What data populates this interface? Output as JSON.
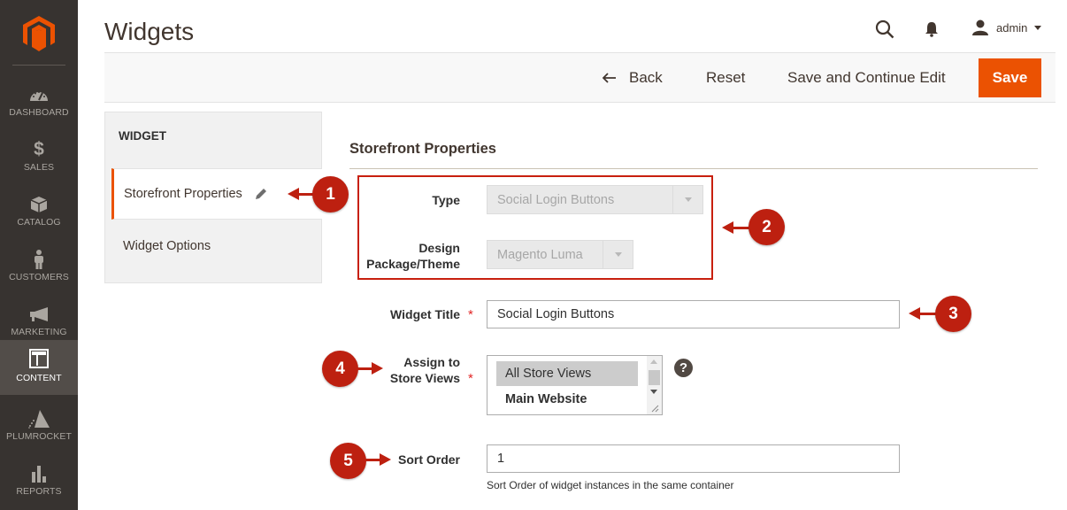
{
  "sidebar": {
    "logo": "magento-logo",
    "items": [
      {
        "label": "DASHBOARD",
        "icon": "dashboard-gauge-icon",
        "active": false
      },
      {
        "label": "SALES",
        "icon": "dollar-icon",
        "active": false
      },
      {
        "label": "CATALOG",
        "icon": "box-icon",
        "active": false
      },
      {
        "label": "CUSTOMERS",
        "icon": "person-icon",
        "active": false
      },
      {
        "label": "MARKETING",
        "icon": "megaphone-icon",
        "active": false
      },
      {
        "label": "CONTENT",
        "icon": "layout-icon",
        "active": true
      },
      {
        "label": "PLUMROCKET",
        "icon": "pyramid-icon",
        "active": false
      },
      {
        "label": "REPORTS",
        "icon": "bar-chart-icon",
        "active": false
      }
    ]
  },
  "header": {
    "title": "Widgets",
    "user": "admin",
    "search_icon": "search-icon",
    "notifications_icon": "bell-icon"
  },
  "actions": {
    "back": "Back",
    "reset": "Reset",
    "save_continue": "Save and Continue Edit",
    "save": "Save"
  },
  "tabs": {
    "heading": "WIDGET",
    "items": [
      {
        "label": "Storefront Properties",
        "active": true
      },
      {
        "label": "Widget Options",
        "active": false
      }
    ]
  },
  "form": {
    "section_title": "Storefront Properties",
    "type": {
      "label": "Type",
      "value": "Social Login Buttons"
    },
    "theme": {
      "label_line1": "Design",
      "label_line2": "Package/Theme",
      "value": "Magento Luma"
    },
    "widget_title": {
      "label": "Widget Title",
      "value": "Social Login Buttons",
      "required": true
    },
    "store_views": {
      "label_line1": "Assign to",
      "label_line2": "Store Views",
      "required": true,
      "options": [
        {
          "label": "All Store Views",
          "selected": true
        },
        {
          "label": "Main Website",
          "group": true
        }
      ]
    },
    "sort_order": {
      "label": "Sort Order",
      "value": "1",
      "note": "Sort Order of widget instances in the same container"
    },
    "required_mark": "*",
    "help_glyph": "?"
  },
  "annotations": [
    "1",
    "2",
    "3",
    "4",
    "5"
  ],
  "colors": {
    "accent": "#eb5202",
    "sidebar_bg": "#373330",
    "annotation": "#bd2010"
  }
}
